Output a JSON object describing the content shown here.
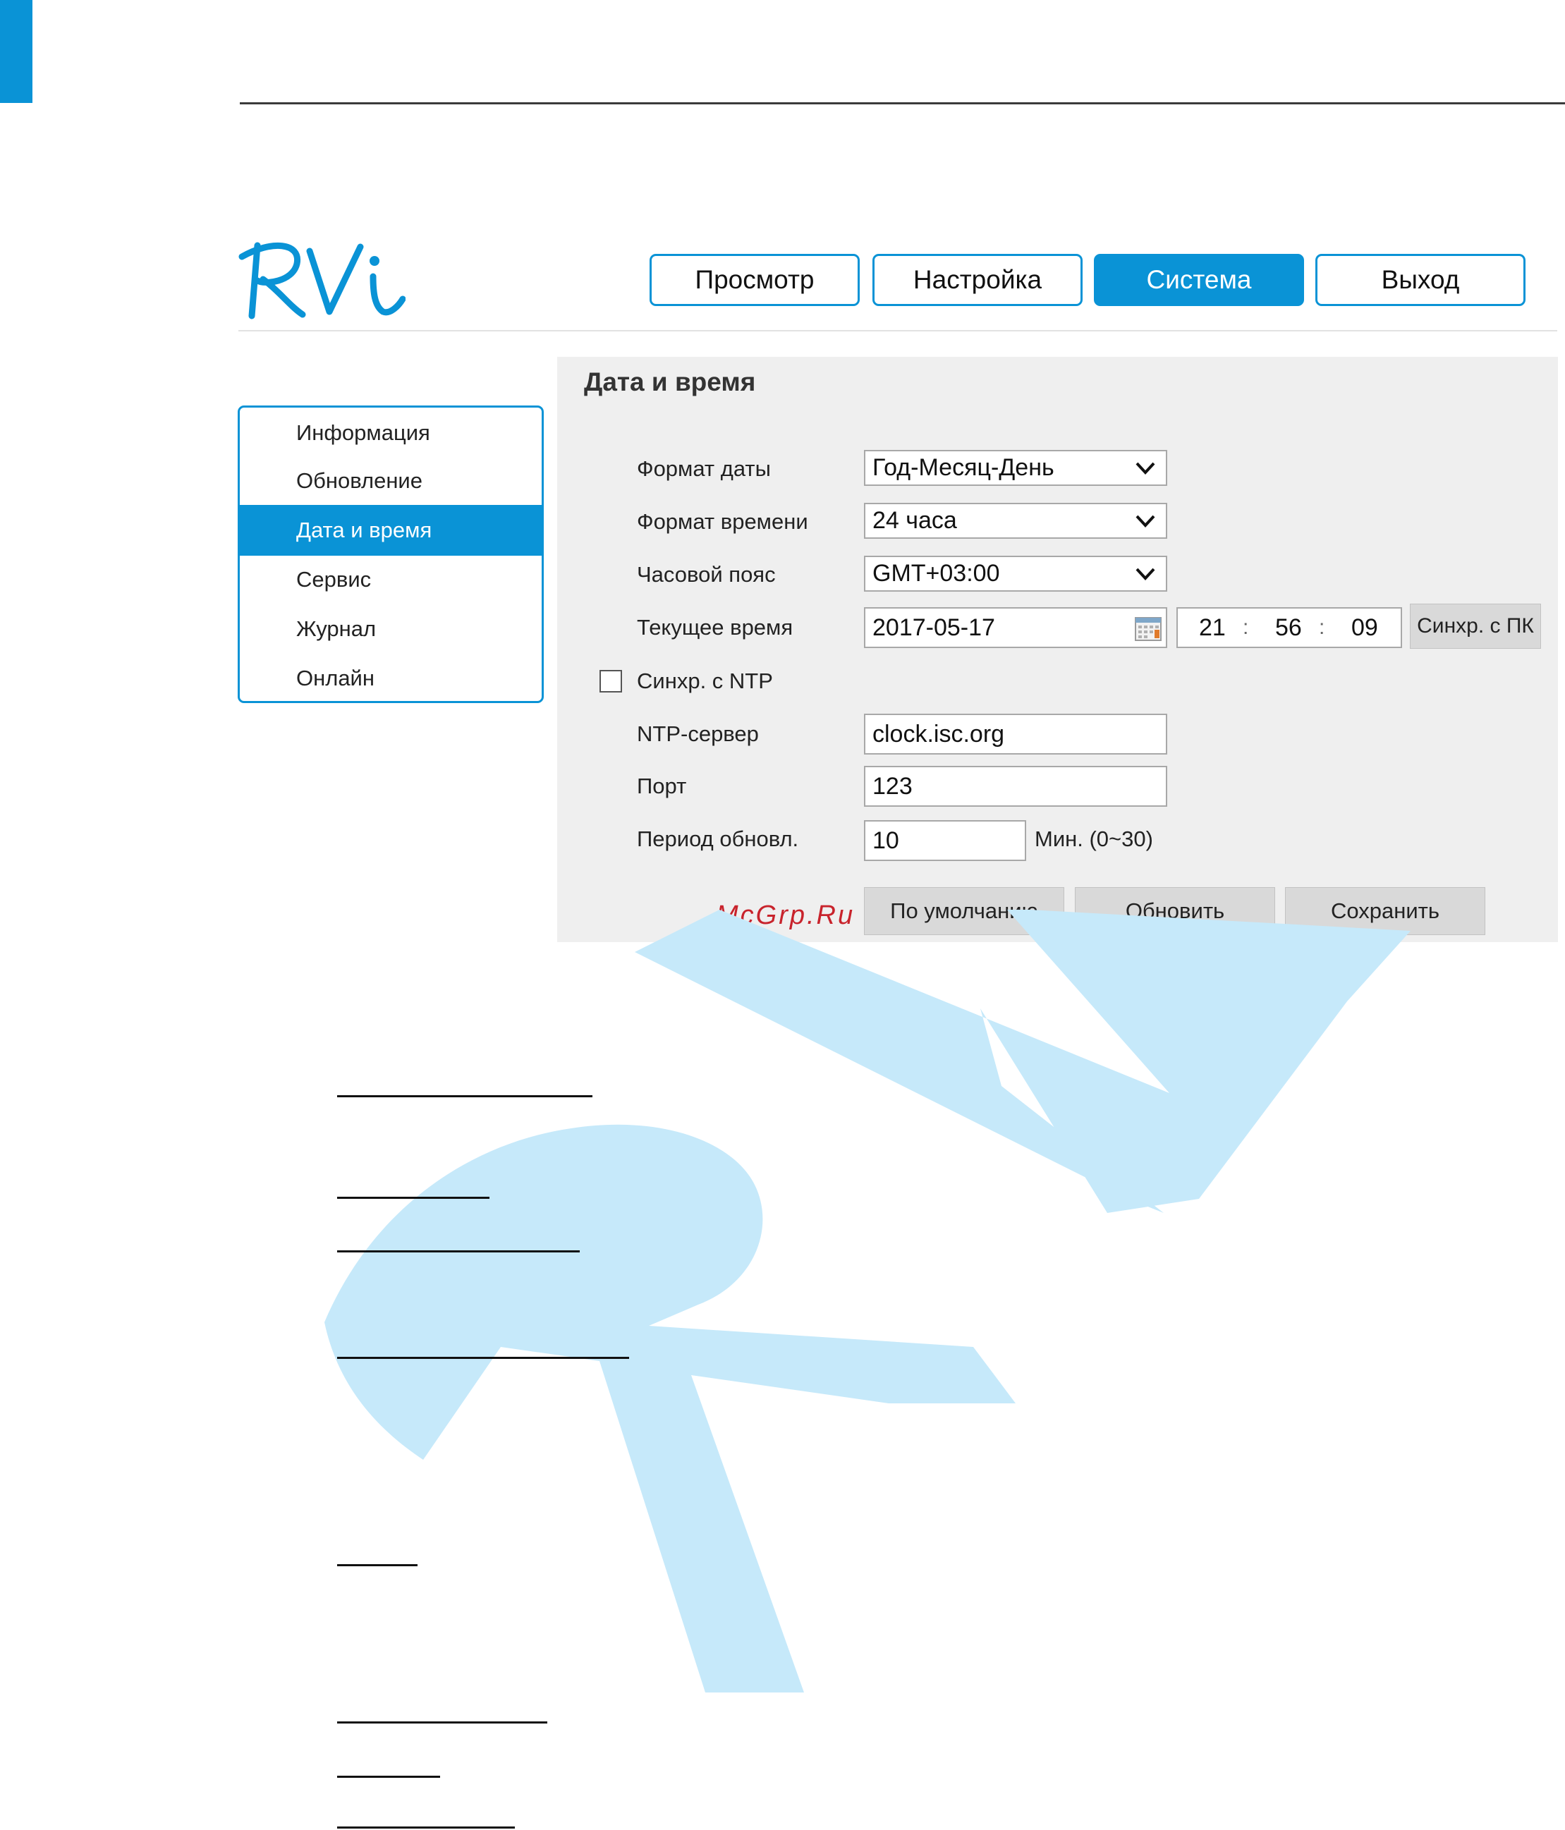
{
  "nav": {
    "buttons": [
      {
        "label": "Просмотр"
      },
      {
        "label": "Настройка"
      },
      {
        "label": "Система"
      },
      {
        "label": "Выход"
      }
    ],
    "active": "Система"
  },
  "sidebar": {
    "items": [
      {
        "label": "Информация"
      },
      {
        "label": "Обновление"
      },
      {
        "label": "Дата и время"
      },
      {
        "label": "Сервис"
      },
      {
        "label": "Журнал"
      },
      {
        "label": "Онлайн"
      }
    ],
    "active": "Дата и время"
  },
  "panel": {
    "title": "Дата и время",
    "date_format": {
      "label": "Формат даты",
      "value": "Год-Месяц-День"
    },
    "time_format": {
      "label": "Формат времени",
      "value": "24 часа"
    },
    "timezone": {
      "label": "Часовой пояс",
      "value": "GMT+03:00"
    },
    "current_time": {
      "label": "Текущее время",
      "date": "2017-05-17",
      "hours": "21",
      "minutes": "56",
      "seconds": "09",
      "separator": ":",
      "sync_pc_label": "Синхр. с ПК"
    },
    "ntp_sync": {
      "label": "Синхр. с NTP",
      "checked": false
    },
    "ntp_server": {
      "label": "NTP-сервер",
      "value": "clock.isc.org"
    },
    "port": {
      "label": "Порт",
      "value": "123"
    },
    "update_period": {
      "label": "Период обновл.",
      "value": "10",
      "unit": "Мин. (0~30)"
    },
    "buttons": {
      "default_label": "По умолчанию",
      "refresh_label": "Обновить",
      "save_label": "Сохранить"
    }
  },
  "watermark_text": "McGrp.Ru",
  "colors": {
    "accent": "#0a93d6",
    "panel_bg": "#efefef",
    "watermark": "#c6e9fa",
    "watermark_text": "#c8232c"
  }
}
